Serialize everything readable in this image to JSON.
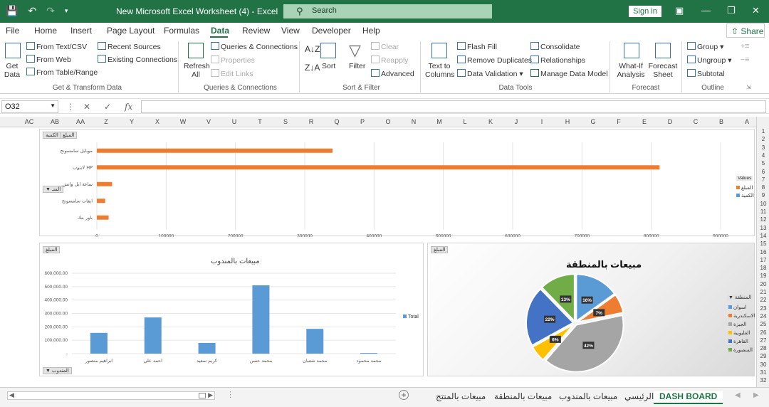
{
  "window": {
    "title": "New Microsoft Excel Worksheet (4)  -  Excel",
    "search_label": "Search",
    "sign_in": "Sign in"
  },
  "menu": [
    "File",
    "Home",
    "Insert",
    "Page Layout",
    "Formulas",
    "Data",
    "Review",
    "View",
    "Developer",
    "Help"
  ],
  "menu_active": "Data",
  "share_label": "Share",
  "ribbon": {
    "get_data": "Get\nData",
    "from_text_csv": "From Text/CSV",
    "from_web": "From Web",
    "from_table_range": "From Table/Range",
    "recent_sources": "Recent Sources",
    "existing_connections": "Existing Connections",
    "group_get_transform": "Get & Transform Data",
    "refresh_all": "Refresh\nAll",
    "queries_connections": "Queries & Connections",
    "properties": "Properties",
    "edit_links": "Edit Links",
    "group_queries": "Queries & Connections",
    "sort": "Sort",
    "filter": "Filter",
    "clear": "Clear",
    "reapply": "Reapply",
    "advanced": "Advanced",
    "group_sort_filter": "Sort & Filter",
    "text_to_columns": "Text to\nColumns",
    "flash_fill": "Flash Fill",
    "remove_duplicates": "Remove Duplicates",
    "data_validation": "Data Validation",
    "consolidate": "Consolidate",
    "relationships": "Relationships",
    "manage_data_model": "Manage Data Model",
    "group_data_tools": "Data Tools",
    "what_if": "What-If\nAnalysis",
    "forecast_sheet": "Forecast\nSheet",
    "group_forecast": "Forecast",
    "group_btn": "Group",
    "ungroup_btn": "Ungroup",
    "subtotal": "Subtotal",
    "group_outline": "Outline"
  },
  "formula_bar": {
    "name_box": "O32",
    "fx": "fx",
    "value": ""
  },
  "columns": [
    "AC",
    "AB",
    "AA",
    "Z",
    "Y",
    "X",
    "W",
    "V",
    "U",
    "T",
    "S",
    "R",
    "Q",
    "P",
    "O",
    "N",
    "M",
    "L",
    "K",
    "J",
    "I",
    "H",
    "G",
    "F",
    "E",
    "D",
    "C",
    "B",
    "A"
  ],
  "rows": [
    "1",
    "2",
    "3",
    "4",
    "5",
    "6",
    "7",
    "8",
    "9",
    "10",
    "11",
    "12",
    "13",
    "14",
    "15",
    "16",
    "17",
    "18",
    "19",
    "20",
    "21",
    "22",
    "23",
    "24",
    "25",
    "26",
    "27",
    "28",
    "29",
    "30",
    "31",
    "32"
  ],
  "sheet_tabs": [
    "DASH BOARD",
    "الرئيسي",
    "مبيعات بالمندوب",
    "مبيعات بالمنطقة",
    "مبيعات بالمنتج"
  ],
  "active_sheet": "DASH BOARD",
  "chart_data": [
    {
      "type": "bar",
      "orientation": "horizontal",
      "categories": [
        "موبايل سامسونج",
        "لابتوب HP",
        "ساعة ابل واتش",
        "ايفات سامسونج",
        "باور بنك"
      ],
      "series": [
        {
          "name": "المبلغ",
          "values": [
            340000,
            812000,
            22000,
            12000,
            17000
          ],
          "color": "#ed7d31"
        },
        {
          "name": "الكمية",
          "values": [
            0,
            0,
            0,
            0,
            0
          ],
          "color": "#5b9bd5"
        }
      ],
      "xticks": [
        "0",
        "100000",
        "200000",
        "300000",
        "400000",
        "500000",
        "600000",
        "700000",
        "800000",
        "900000"
      ],
      "xlim": [
        0,
        900000
      ],
      "legend_title": "Values",
      "filter_buttons": [
        "الكمية",
        "المبلغ"
      ],
      "axis_field_button": "المنـ",
      "grid": true,
      "legend": "right"
    },
    {
      "type": "bar",
      "title": "مبيعات بالمندوب",
      "categories": [
        "ابراهيم منصور",
        "احمد علي",
        "كريم سعيد",
        "محمد حسن",
        "محمد شعبان",
        "محمد محمود"
      ],
      "series": [
        {
          "name": "Total",
          "values": [
            155000,
            270000,
            80000,
            510000,
            185000,
            5000
          ],
          "color": "#5b9bd5"
        }
      ],
      "yticks": [
        "-",
        "100,000.00",
        "200,000.00",
        "300,000.00",
        "400,000.00",
        "500,000.00",
        "600,000.00"
      ],
      "ylim": [
        0,
        600000
      ],
      "filter_button": "المبلغ",
      "axis_field_button": "المندوب",
      "grid": true,
      "legend": "right"
    },
    {
      "type": "pie",
      "title": "مبيعات بالمنطقة",
      "categories": [
        "اسوان",
        "الاسكندرية",
        "الجيزة",
        "القليوبية",
        "القاهرة",
        "المنصورة"
      ],
      "values": [
        16,
        7,
        42,
        6,
        22,
        13
      ],
      "labels": [
        "16%",
        "7%",
        "42%",
        "6%",
        "22%",
        "13%"
      ],
      "colors": [
        "#5b9bd5",
        "#ed7d31",
        "#a5a5a5",
        "#ffc000",
        "#4472c4",
        "#70ad47"
      ],
      "legend_title": "المنطقة",
      "filter_button": "المبلغ",
      "legend": "right"
    }
  ]
}
